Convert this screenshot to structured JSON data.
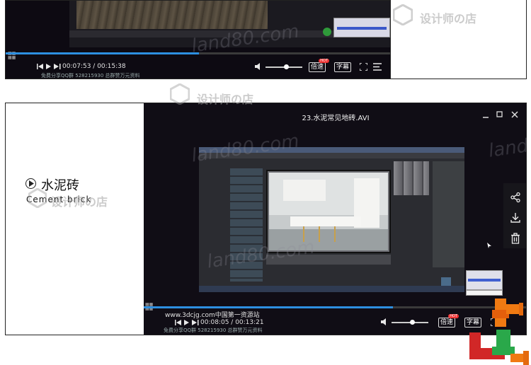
{
  "top_player": {
    "time_current": "00:07:53",
    "time_total": "00:15:38",
    "time_separator": " / ",
    "watermark_small": "免费分享QQ群 528215930 总群赞万元资料",
    "speed_label": "倍速",
    "subtitle_label": "字幕",
    "hot_badge": "HOT",
    "progress": 0.5,
    "volume": 0.55
  },
  "title_card": {
    "title_cn": "水泥砖",
    "title_en": "Cement brick"
  },
  "main_player": {
    "file_title": "23.水泥常见地砖.AVI",
    "time_current": "00:08:05",
    "time_total": "00:13:21",
    "time_separator": " / ",
    "watermark_url": "www.3dcjg.com中国第一资源站",
    "watermark_small": "免费分享QQ群 528215930 总群赞万元资料",
    "speed_label": "倍速",
    "subtitle_label": "字幕",
    "hot_badge": "HOT",
    "progress": 0.65,
    "volume": 0.55
  },
  "watermarks": {
    "shop_name": "设计师の店",
    "land_text": "land80.com",
    "land_short": "land"
  },
  "icons": {
    "share": "share-icon",
    "download": "download-icon",
    "delete": "trash-icon",
    "minimize": "minimize-icon",
    "maximize": "maximize-icon",
    "close": "close-icon"
  },
  "colors": {
    "progress_blue": "#2d8fe0",
    "player_bg": "#100d15",
    "hot_red": "#e33333"
  }
}
